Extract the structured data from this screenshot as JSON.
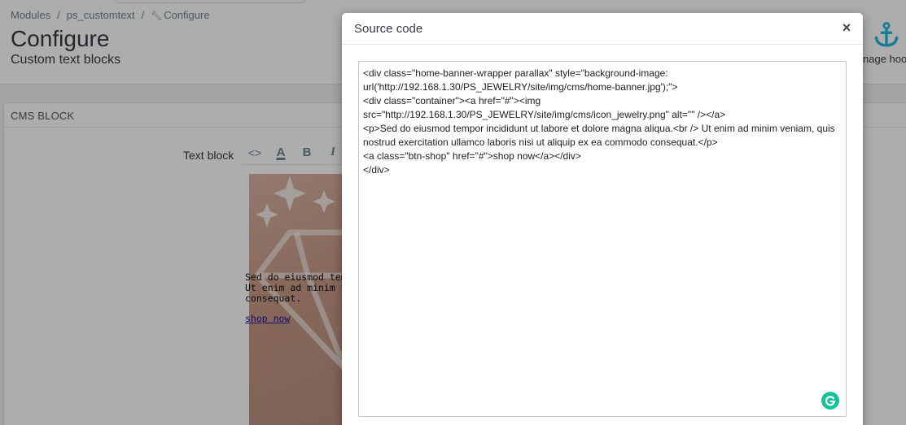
{
  "breadcrumb": {
    "items": [
      "Modules",
      "ps_customtext",
      "Configure"
    ],
    "separator": "/"
  },
  "header": {
    "title": "Configure",
    "subtitle": "Custom text blocks",
    "toolbar_button_label": "nage hoo"
  },
  "panel": {
    "heading": "CMS BLOCK",
    "field_label": "Text block"
  },
  "editor": {
    "toolbar": [
      "<>",
      "A",
      "B",
      "I"
    ],
    "preview_text_lines": [
      "Sed do eiusmod tem",
      "Ut enim ad minim ve",
      "consequat."
    ],
    "preview_link": "shop now"
  },
  "modal": {
    "title": "Source code",
    "close_label": "×",
    "code_lines": [
      "<div class=\"home-banner-wrapper parallax\" style=\"background-image: url('http://192.168.1.30/PS_JEWELRY/site/img/cms/home-banner.jpg');\">",
      "<div class=\"container\"><a href=\"#\"><img src=\"http://192.168.1.30/PS_JEWELRY/site/img/cms/icon_jewelry.png\" alt=\"\" /></a>",
      "<p>Sed do eiusmod tempor incididunt ut labore et dolore magna aliqua.<br /> Ut enim ad minim veniam, quis nostrud exercitation ullamco laboris nisi ut aliquip ex ea commodo consequat.</p>",
      "<a class=\"btn-shop\" href=\"#\">shop now</a></div>",
      "</div>"
    ]
  },
  "colors": {
    "accent": "#25b9d7",
    "grammarly": "#15c39a",
    "overlay": "rgba(0,0,0,0.32)"
  }
}
